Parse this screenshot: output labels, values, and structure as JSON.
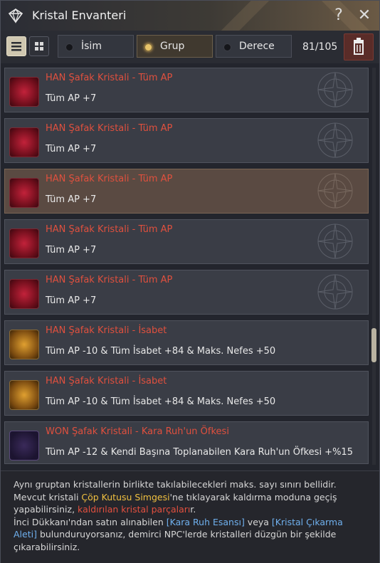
{
  "window": {
    "title": "Kristal Envanteri",
    "help_label": "?",
    "close_label": "✕"
  },
  "toolbar": {
    "sort_options": [
      {
        "label": "İsim",
        "active": false
      },
      {
        "label": "Grup",
        "active": true
      },
      {
        "label": "Derece",
        "active": false
      }
    ],
    "count": "81/105"
  },
  "crystals": [
    {
      "name": "HAN Şafak Kristali - Tüm AP",
      "stat": "Tüm AP +7",
      "color": "red",
      "selected": false
    },
    {
      "name": "HAN Şafak Kristali - Tüm AP",
      "stat": "Tüm AP +7",
      "color": "red",
      "selected": false
    },
    {
      "name": "HAN Şafak Kristali - Tüm AP",
      "stat": "Tüm AP +7",
      "color": "red",
      "selected": true
    },
    {
      "name": "HAN Şafak Kristali - Tüm AP",
      "stat": "Tüm AP +7",
      "color": "red",
      "selected": false
    },
    {
      "name": "HAN Şafak Kristali - Tüm AP",
      "stat": "Tüm AP +7",
      "color": "red",
      "selected": false
    },
    {
      "name": "HAN Şafak Kristali - İsabet",
      "stat": "Tüm AP -10 & Tüm İsabet +84 & Maks. Nefes +50",
      "color": "gold",
      "selected": false
    },
    {
      "name": "HAN Şafak Kristali - İsabet",
      "stat": "Tüm AP -10 & Tüm İsabet +84 & Maks. Nefes +50",
      "color": "gold",
      "selected": false
    },
    {
      "name": "WON Şafak Kristali - Kara Ruh'un Öfkesi",
      "stat": "Tüm AP -12 & Kendi Başına Toplanabilen Kara Ruh'un Öfkesi +%15",
      "color": "purple",
      "selected": false
    }
  ],
  "info": {
    "line1": "Aynı gruptan kristallerin birlikte takılabilecekleri maks. sayı sınırı bellidir.",
    "line2_a": "Mevcut kristali ",
    "line2_b": "Çöp Kutusu Simgesi",
    "line2_c": "'ne tıklayarak kaldırma moduna geçiş",
    "line3_a": "yapabilirsiniz, ",
    "line3_b": "kaldırılan kristal parçaları",
    "line3_c": "r.",
    "line4_a": "İnci Dükkanı'ndan satın alınabilen ",
    "line4_b": "[Kara Ruh Esansı]",
    "line4_c": " veya ",
    "line4_d": "[Kristal Çıkarma",
    "line5_a": "Aleti]",
    "line5_b": " bulunduruyorsanız, demirci NPC'lerde kristalleri düzgün bir şekilde",
    "line6": "çıkarabilirsiniz."
  }
}
